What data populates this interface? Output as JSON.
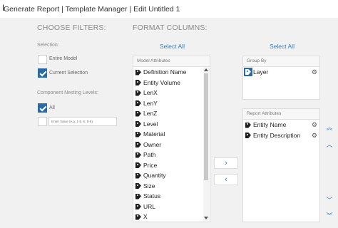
{
  "window": {
    "title": "Generate Report | Template Manager | Edit Untitled 1"
  },
  "filters": {
    "heading": "CHOOSE FILTERS:",
    "selection_label": "Selection:",
    "options": [
      {
        "label": "Entire Model",
        "checked": false
      },
      {
        "label": "Current Selection",
        "checked": true
      }
    ],
    "nesting_label": "Component Nesting Levels:",
    "all_label": "All",
    "all_checked": true,
    "order_placeholder": "Enter Value (e.g. 1-5, 6, 6-8)"
  },
  "format": {
    "heading": "FORMAT COLUMNS:",
    "select_all_label": "Select All",
    "model_attributes_header": "Model Attributes",
    "model_attributes": [
      "Definition Name",
      "Entity Volume",
      "LenX",
      "LenY",
      "LenZ",
      "Level",
      "Material",
      "Owner",
      "Path",
      "Price",
      "Quantity",
      "Size",
      "Status",
      "URL",
      "X"
    ]
  },
  "move": {
    "right_label": "›",
    "left_label": "‹"
  },
  "group_by": {
    "select_all_label": "Select All",
    "header": "Group By",
    "items": [
      "Layer"
    ]
  },
  "report_attributes": {
    "header": "Report Attributes",
    "items": [
      "Entity Name",
      "Entity Description"
    ]
  },
  "icons": {
    "tag": "tag-icon",
    "gear": "gear-icon",
    "cursor": "text-cursor-icon"
  },
  "colors": {
    "accent": "#2c7fc7",
    "checkbox": "#2c6aa6"
  }
}
